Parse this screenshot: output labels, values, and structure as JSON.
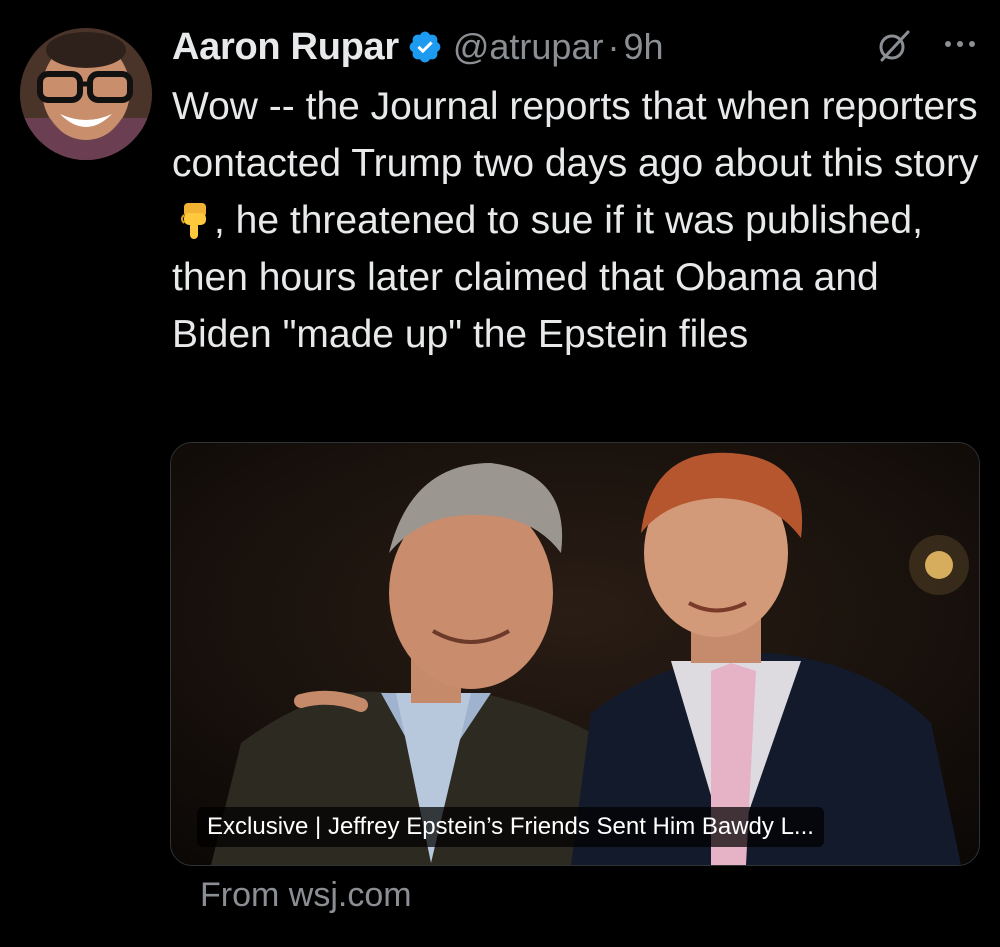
{
  "tweet": {
    "author_name": "Aaron Rupar",
    "handle": "@atrupar",
    "separator": "·",
    "time": "9h",
    "text_before_emoji": "Wow -- the Journal reports that when reporters contacted Trump two days ago about this story",
    "emoji": "pointing-down-emoji",
    "text_after_emoji": ", he threatened to sue if it was published, then hours later claimed that Obama and Biden \"made up\" the Epstein files"
  },
  "link_card": {
    "caption": "Exclusive | Jeffrey Epstein’s Friends Sent Him Bawdy L...",
    "source": "From wsj.com"
  },
  "icons": {
    "verified": "verified-badge-icon",
    "grok": "grok-icon",
    "more": "more-icon"
  },
  "colors": {
    "background": "#000000",
    "text_primary": "#e7e9ea",
    "text_secondary": "#8b8f94",
    "verified_blue": "#1d9bf0",
    "card_border": "#2f3336"
  }
}
